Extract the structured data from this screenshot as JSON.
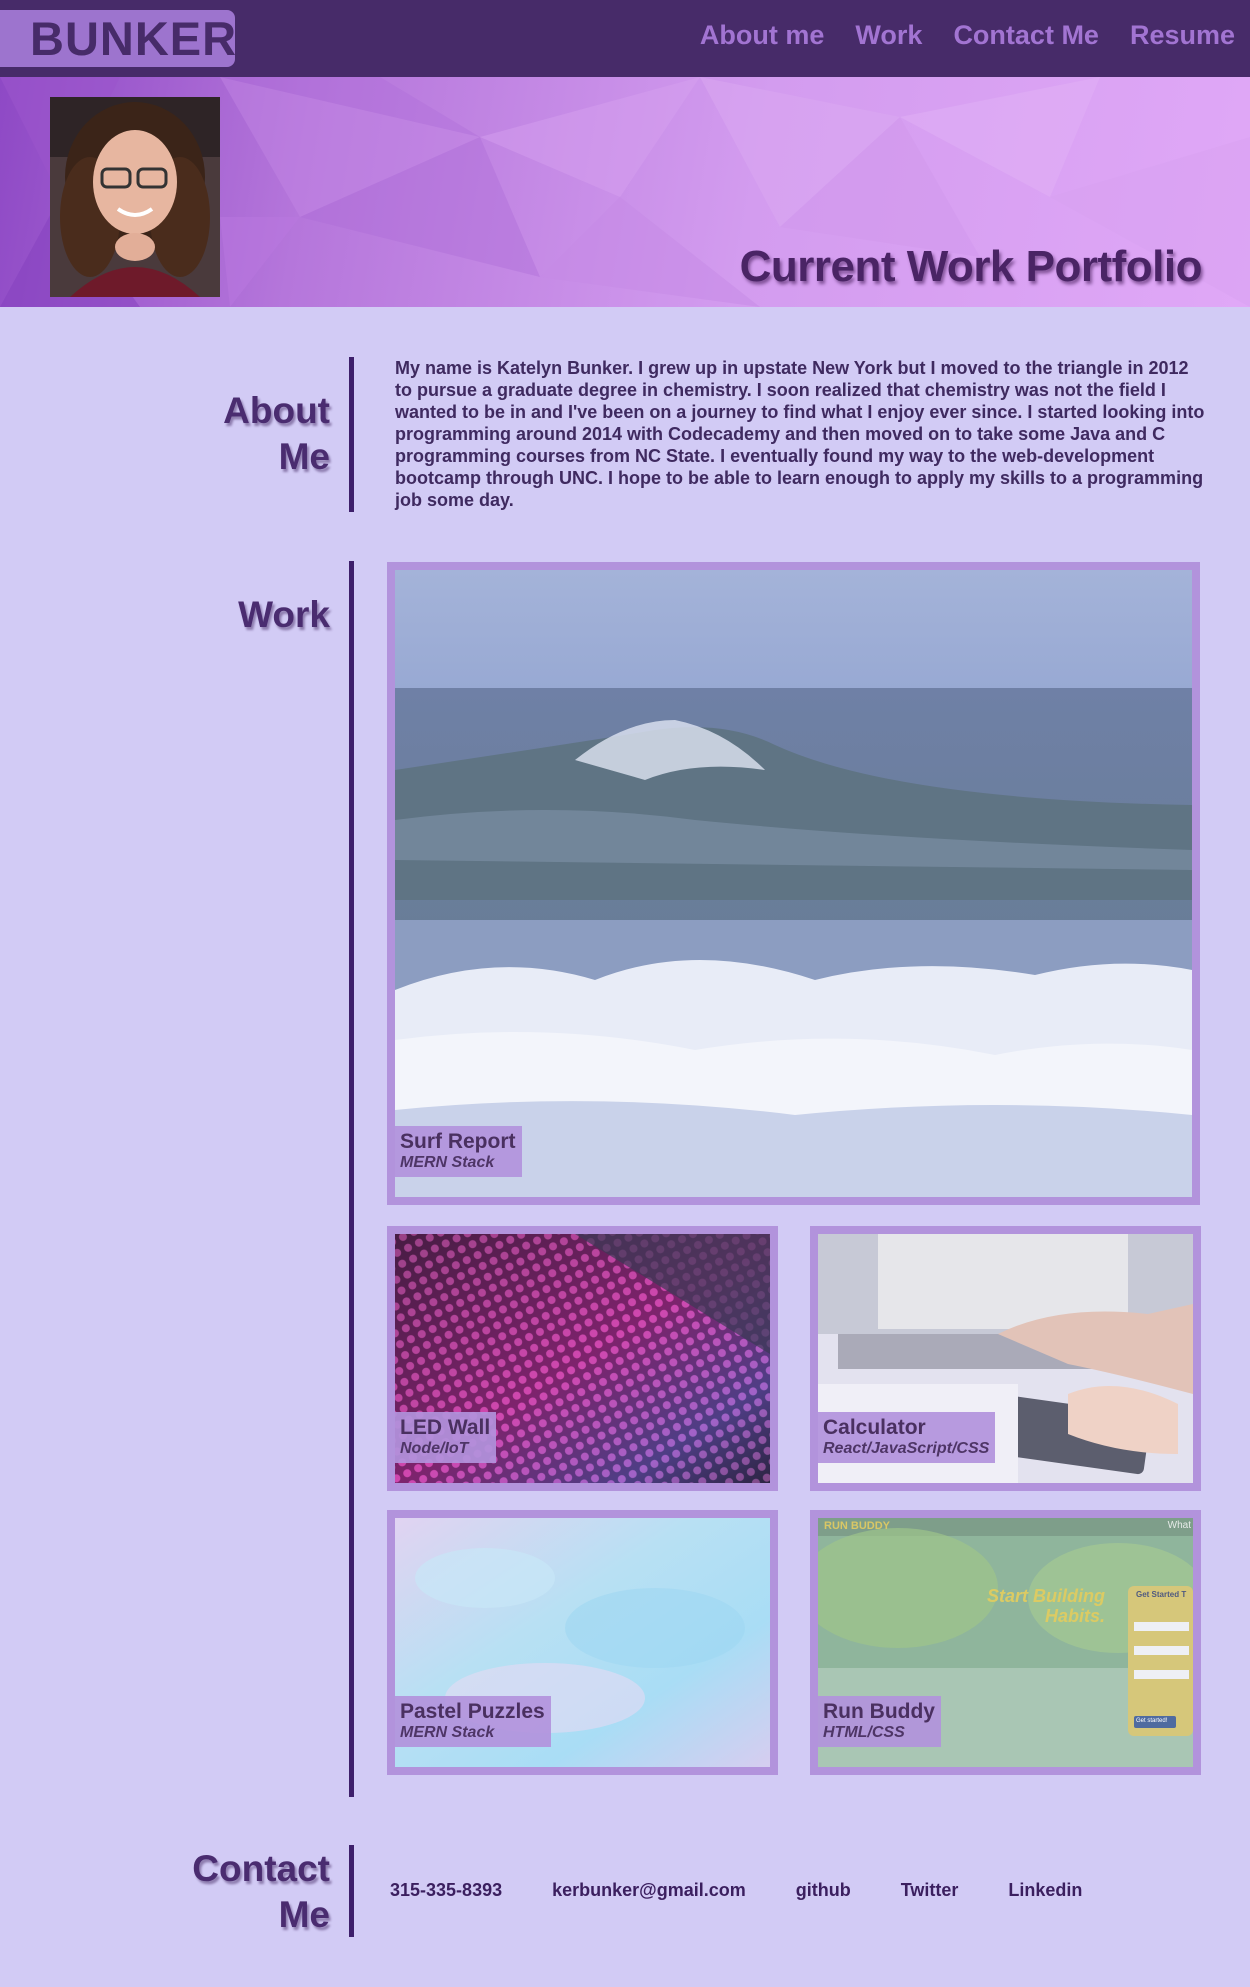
{
  "nav": {
    "brand": "BUNKER",
    "links": [
      "About me",
      "Work",
      "Contact Me",
      "Resume"
    ]
  },
  "hero": {
    "title": "Current Work Portfolio"
  },
  "about": {
    "heading_line1": "About",
    "heading_line2": "Me",
    "text": "My name is Katelyn Bunker. I grew up in upstate New York but I moved to the triangle in 2012 to pursue a graduate degree in chemistry. I soon realized that chemistry was not the field I wanted to be in and I've been on a journey to find what I enjoy ever since. I started looking into programming around 2014 with Codecademy and then moved on to take some Java and C programming courses from NC State. I eventually found my way to the web-development bootcamp through UNC. I hope to be able to learn enough to apply my skills to a programming job some day."
  },
  "work": {
    "heading": "Work",
    "projects": [
      {
        "title": "Surf Report",
        "stack": "MERN Stack"
      },
      {
        "title": "LED Wall",
        "stack": "Node/IoT"
      },
      {
        "title": "Calculator",
        "stack": "React/JavaScript/CSS"
      },
      {
        "title": "Pastel Puzzles",
        "stack": "MERN Stack"
      },
      {
        "title": "Run Buddy",
        "stack": "HTML/CSS"
      }
    ],
    "runbuddy_screenshot": {
      "brand": "RUN BUDDY",
      "nav": "What",
      "headline1": "Start Building",
      "headline2": "Habits.",
      "form_title": "Get Started T",
      "button": "Get started!"
    }
  },
  "contact": {
    "heading_line1": "Contact",
    "heading_line2": "Me",
    "items": [
      "315-335-8393",
      "kerbunker@gmail.com",
      "github",
      "Twitter",
      "Linkedin"
    ]
  },
  "colors": {
    "page_bg": "#d2cbf5",
    "nav_bg": "#472b69",
    "brand_bg": "#9d74ce",
    "nav_link": "#a274d2",
    "card_border": "#b293dc",
    "divider": "#3e1f6b"
  }
}
